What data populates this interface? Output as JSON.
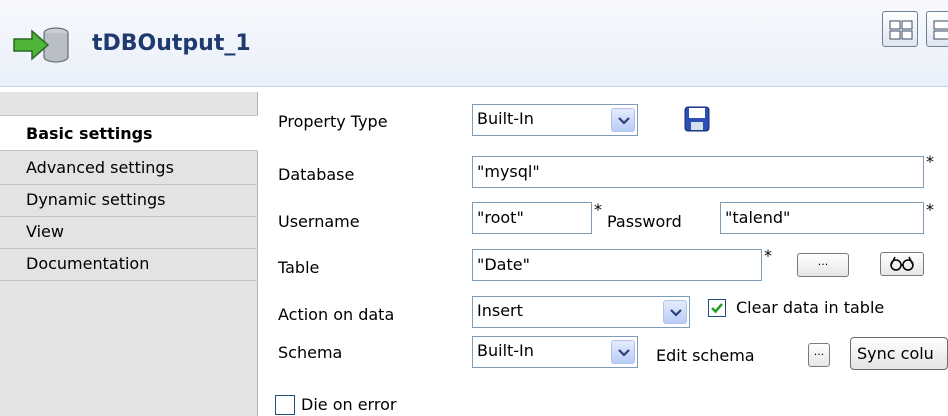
{
  "component": {
    "title": "tDBOutput_1"
  },
  "tabs": [
    {
      "label": "Basic settings",
      "active": true
    },
    {
      "label": "Advanced settings"
    },
    {
      "label": "Dynamic settings"
    },
    {
      "label": "View"
    },
    {
      "label": "Documentation"
    }
  ],
  "form": {
    "property_type": {
      "label": "Property Type",
      "value": "Built-In"
    },
    "database": {
      "label": "Database",
      "value": "\"mysql\"",
      "required": "*"
    },
    "username": {
      "label": "Username",
      "value": "\"root\"",
      "required": "*"
    },
    "password": {
      "label": "Password",
      "value": "\"talend\"",
      "required": "*"
    },
    "table": {
      "label": "Table",
      "value": "\"Date\"",
      "required": "*",
      "browse": "..."
    },
    "action_on_data": {
      "label": "Action on data",
      "value": "Insert"
    },
    "clear_data": {
      "label": "Clear data in table",
      "checked": true
    },
    "schema": {
      "label": "Schema",
      "value": "Built-In",
      "edit_label": "Edit schema",
      "edit_btn": "...",
      "sync_label": "Sync colu"
    },
    "die_on_error": {
      "label": "Die on error",
      "checked": false
    }
  },
  "colors": {
    "accent": "#1f3a6e",
    "header_bg": "#e9eff9",
    "tabs_bg": "#e3e3e3",
    "field_border": "#7f9db9"
  }
}
